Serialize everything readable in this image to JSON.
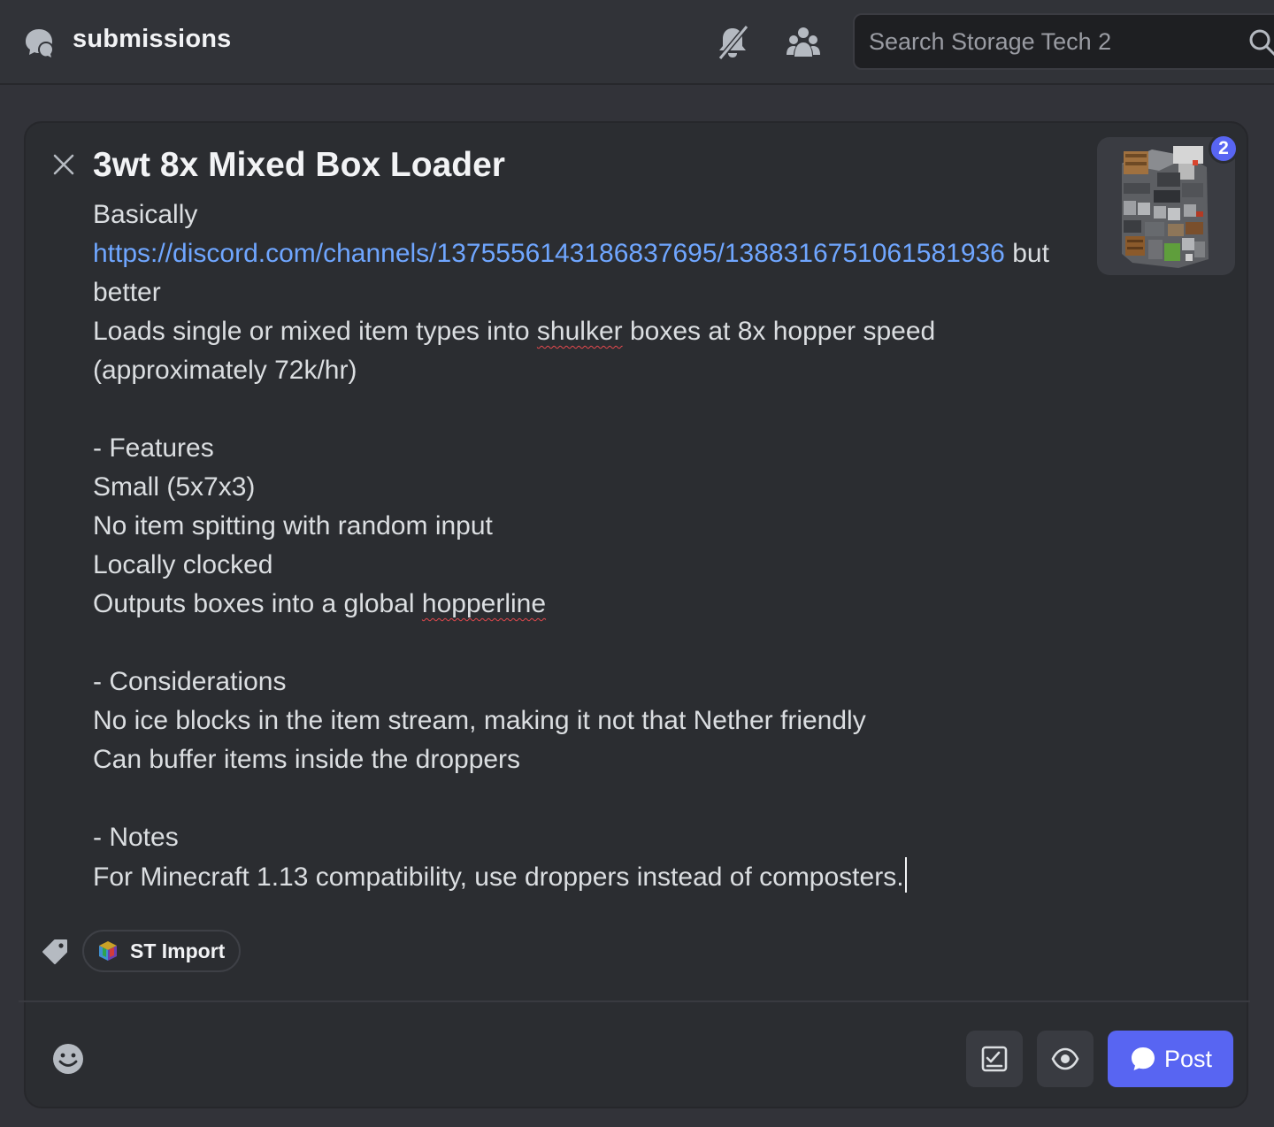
{
  "header": {
    "channel_name": "submissions",
    "search_placeholder": "Search Storage Tech 2"
  },
  "post": {
    "title": "3wt 8x Mixed Box Loader",
    "body": {
      "line1": "Basically",
      "link": "https://discord.com/channels/1375556143186837695/1388316751061581936",
      "link_suffix": " but",
      "line3": "better",
      "line4_pre": "Loads single or mixed item types into ",
      "line4_misspelled": "shulker",
      "line4_post": " boxes at 8x hopper speed",
      "line5": "(approximately 72k/hr)",
      "features_heading": "- Features",
      "features": [
        "Small (5x7x3)",
        "No item spitting with random input",
        "Locally clocked"
      ],
      "feature4_pre": "Outputs boxes into a global ",
      "feature4_misspelled": "hopperline",
      "considerations_heading": "- Considerations",
      "considerations": [
        "No ice blocks in the item stream, making it not that Nether friendly",
        "Can buffer items inside the droppers"
      ],
      "notes_heading": "- Notes",
      "notes": [
        "For Minecraft 1.13 compatibility, use droppers instead of composters."
      ]
    },
    "attachment_count": "2",
    "tag_label": "ST Import"
  },
  "actions": {
    "post_label": "Post"
  },
  "colors": {
    "accent": "#5865f2",
    "link": "#6fa6ff",
    "background": "#2b2d31"
  }
}
